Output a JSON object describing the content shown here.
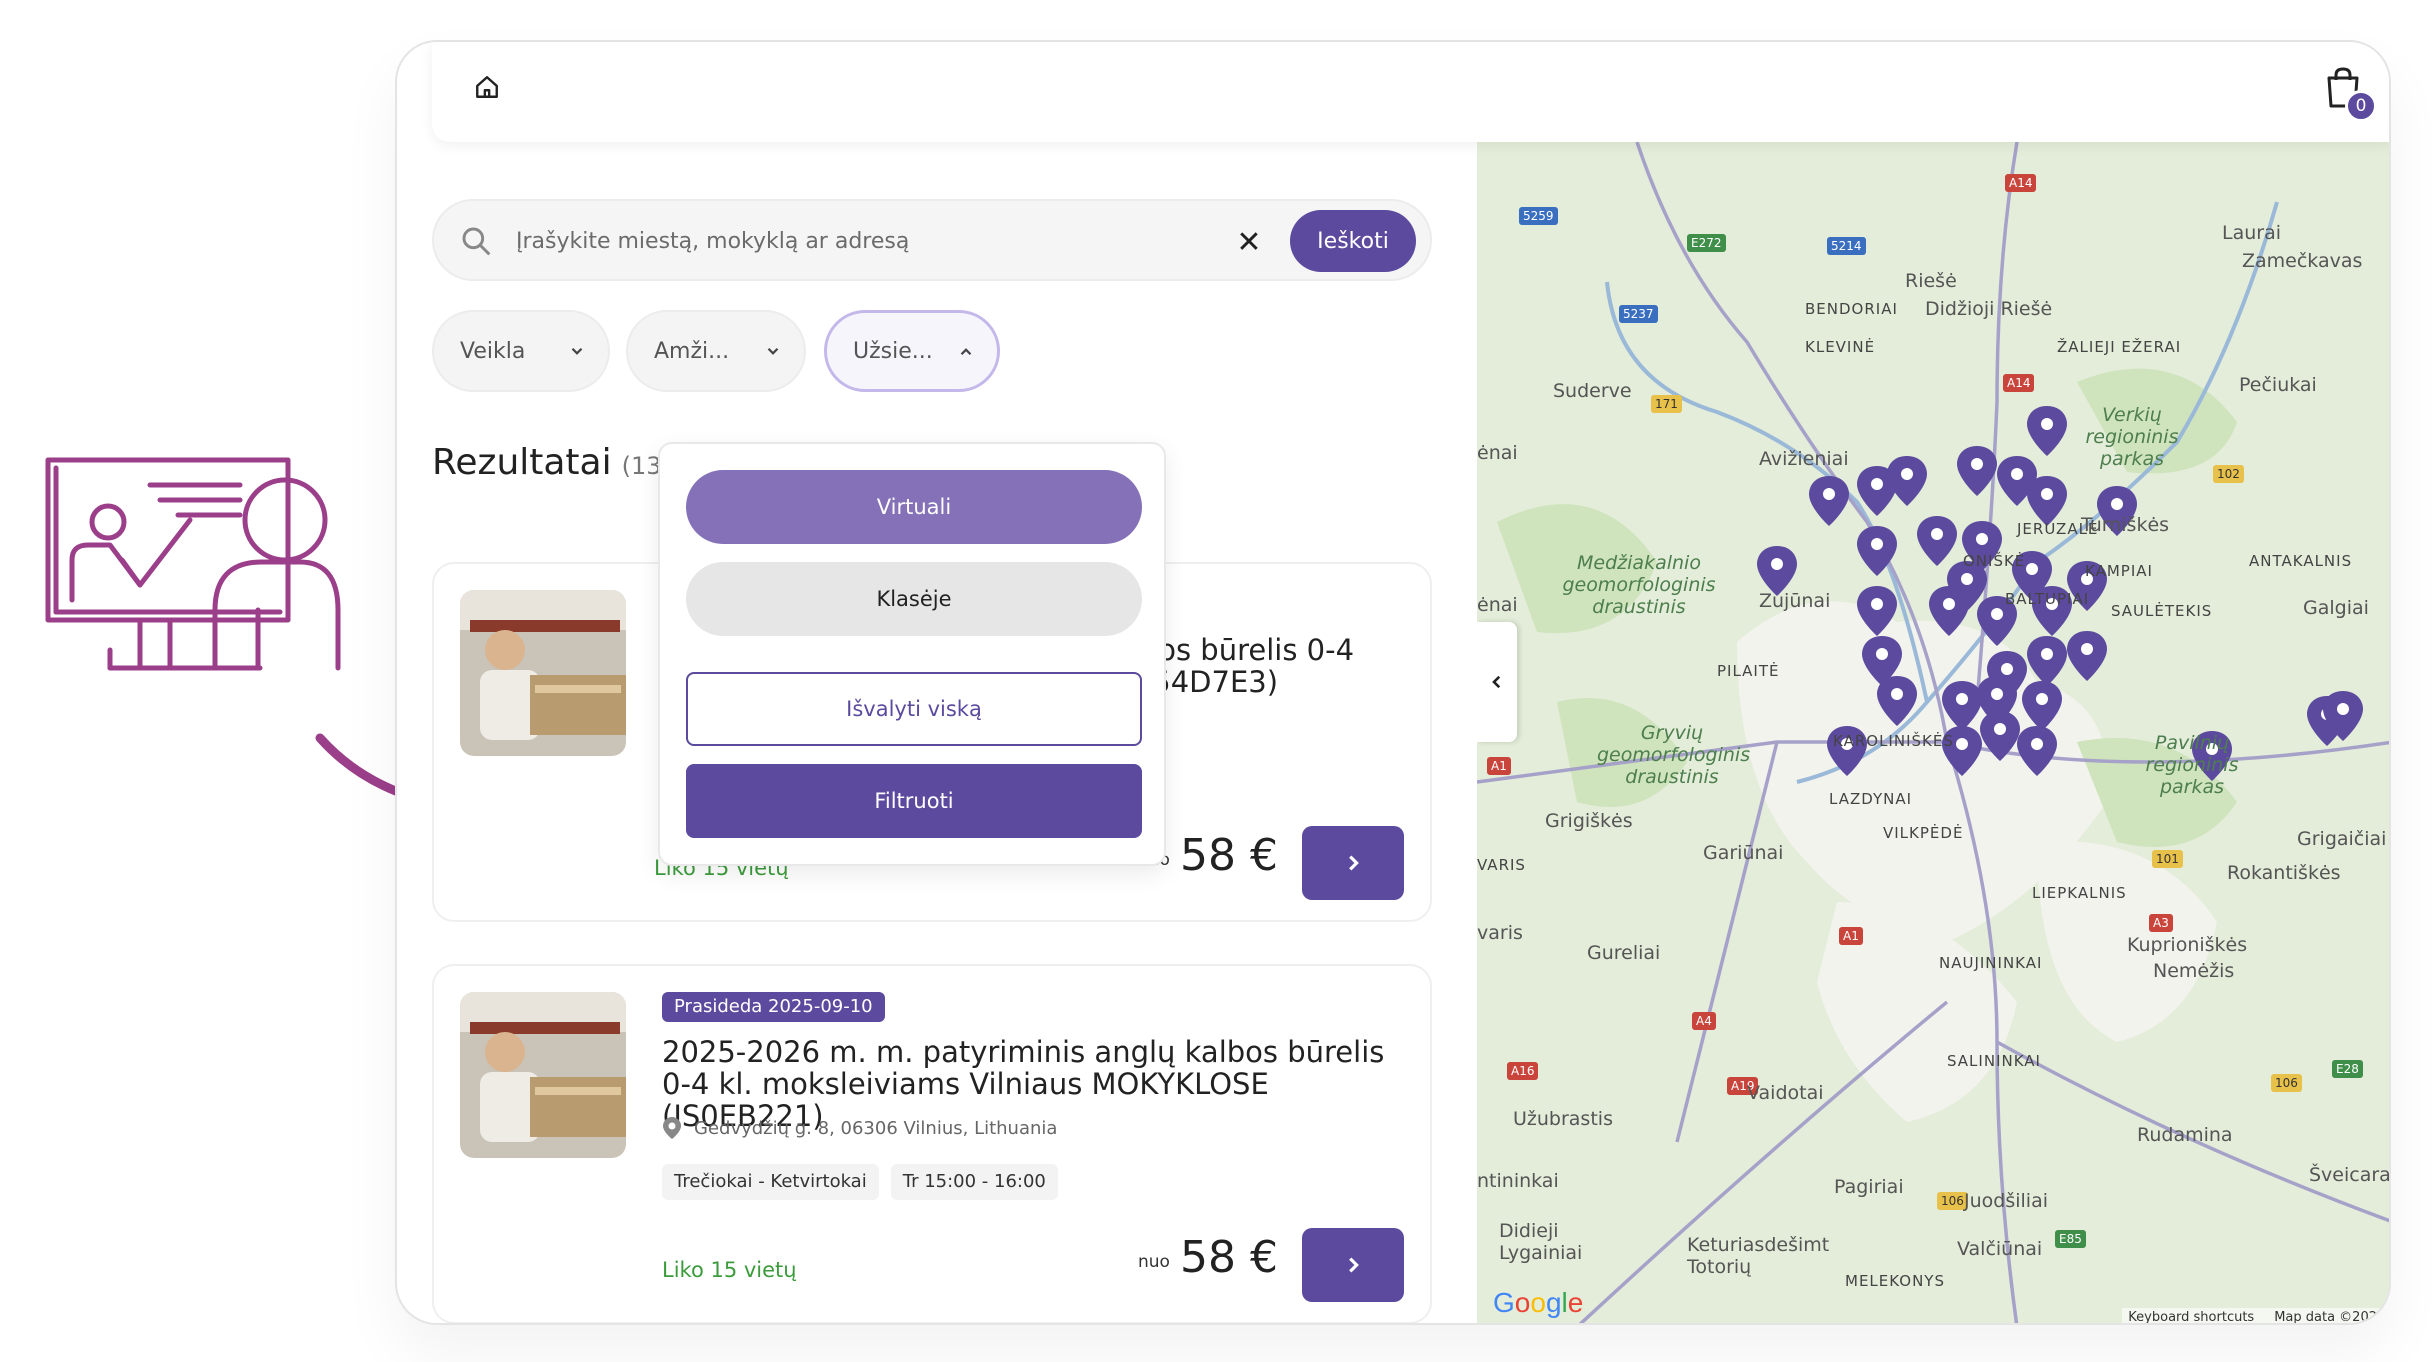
{
  "header": {
    "cart_count": "0"
  },
  "search": {
    "placeholder": "Įrašykite miestą, mokyklą ar adresą",
    "button_label": "Ieškoti"
  },
  "filters": [
    {
      "label": "Veikla"
    },
    {
      "label": "Amži..."
    },
    {
      "label": "Užsie..."
    }
  ],
  "results": {
    "title": "Rezultatai",
    "count": "(134"
  },
  "dropdown": {
    "options": [
      "Virtuali",
      "Klasėje"
    ],
    "clear_label": "Išvalyti viską",
    "apply_label": "Filtruoti"
  },
  "cards": [
    {
      "title_visible": "albos būrelis 0-4\n(IS54D7E3)",
      "spots_partial": "Liko 15 vietų",
      "from": "nuo",
      "price": "58 €"
    },
    {
      "badge": "Prasideda 2025-09-10",
      "title": "2025-2026 m. m. patyriminis anglų kalbos būrelis 0-4 kl. moksleiviams Vilniaus MOKYKLOSE (IS0EB221)",
      "address": "Gedvydžių g. 8, 06306 Vilnius, Lithuania",
      "tags": [
        "Trečiokai - Ketvirtokai",
        "Tr 15:00 - 16:00"
      ],
      "spots": "Liko 15 vietų",
      "from": "nuo",
      "price": "58 €"
    }
  ],
  "map": {
    "places": [
      "Lauraі",
      "Zamečkavas",
      "Riešė",
      "Didžioji Riešė",
      "BENDORIAI",
      "KLEVINĖ",
      "ŽALIEJI EŽERAI",
      "Pečiukai",
      "Suderve",
      "Verkių regioninis parkas",
      "ėnai",
      "Avižieniai",
      "JERUZALĖ",
      "Turniškės",
      "Medžiakalnio geomorfologinis draustinis",
      "ANTAKALNIS",
      "Zujūnai",
      "BALTUPIAI",
      "SAULĖTEKIS",
      "Galgiai",
      "PILAITĖ",
      "Gryvių geomorfologinis draustinis",
      "KAROLINIŠKĖS",
      "Pavilnių regioninis parkas",
      "Grigiškės",
      "LAZDYNAI",
      "VILKPĖDĖ",
      "Gariūnai",
      "Grigaičiai",
      "Rokantiškės",
      "VARIS",
      "LIEPKALNIS",
      "Gureliai",
      "NAUJININKAI",
      "Kuprioniškės",
      "Nemėžis",
      "SALININKAI",
      "Vaidotai",
      "Užubrastis",
      "Rudamina",
      "Šveicarai",
      "Pagiriai",
      "Juodšiliai",
      "Didieji Lygainiai",
      "Keturiasdešimt Totorių",
      "MELEKONYS",
      "Valčiūnai",
      "ntininkai",
      "varis",
      "ėnai",
      "ONIŠKĖ",
      "KAMPIAI"
    ],
    "logo": "Google",
    "footer": [
      "Keyboard shortcuts",
      "Map data ©202"
    ]
  },
  "colors": {
    "primary": "#5b4a9e",
    "primary_light": "#8471b8",
    "illustration": "#9b3f8a",
    "success": "#3c9c3c",
    "map_bg": "#e3edd9"
  },
  "icons": [
    "home-icon",
    "shopping-bag-icon",
    "search-icon",
    "close-icon",
    "chevron-down-icon",
    "chevron-up-icon",
    "chevron-right-icon",
    "location-pin-icon",
    "chevron-left-icon",
    "teacher-board-icon",
    "curved-arrow-icon"
  ]
}
